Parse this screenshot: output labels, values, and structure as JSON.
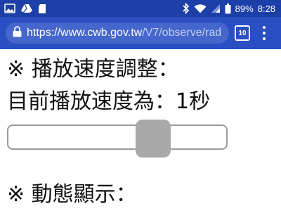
{
  "status_bar": {
    "battery": "89%",
    "time": "8:28",
    "icons": [
      "image-icon",
      "drive-icon",
      "sd-card-icon",
      "bluetooth-icon",
      "wifi-icon",
      "signal-icon",
      "battery-icon"
    ]
  },
  "browser": {
    "url_main": "https://www.cwb.gov.tw",
    "url_rest": "/V7/observe/rad",
    "tab_count": "10",
    "theme_color": "#2a4fc2"
  },
  "page": {
    "speed_heading": "※ 播放速度調整：",
    "speed_current": "目前播放速度為：1秒",
    "dynamic_heading": "※ 動態顯示："
  },
  "slider": {
    "level": 0.6
  }
}
